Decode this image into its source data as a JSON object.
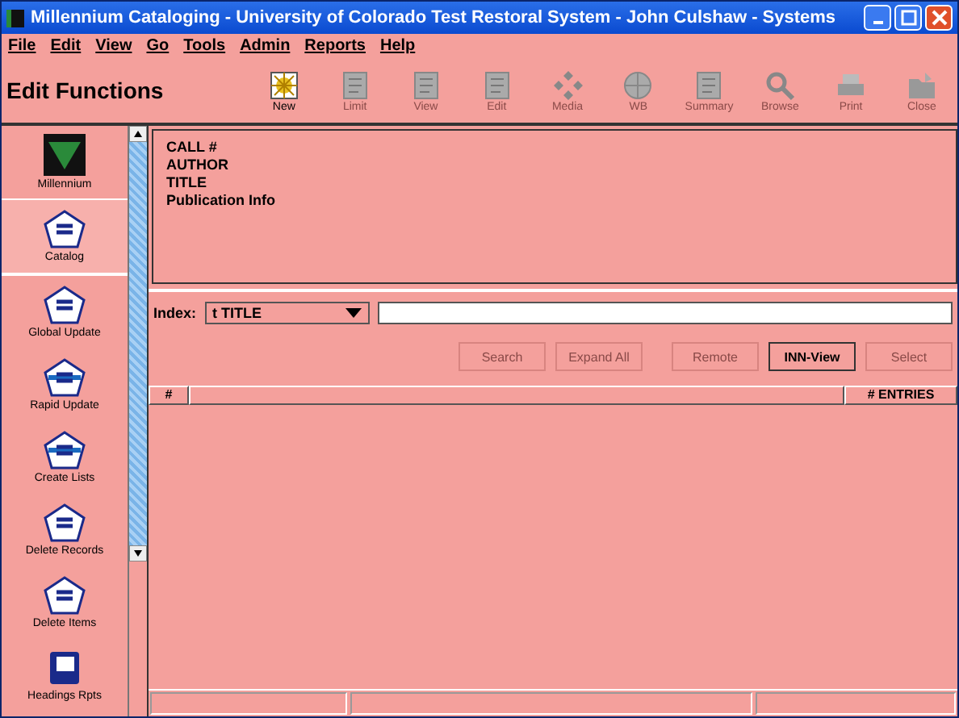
{
  "window": {
    "title": "Millennium Cataloging - University of Colorado Test Restoral System - John Culshaw - Systems"
  },
  "menu": [
    "File",
    "Edit",
    "View",
    "Go",
    "Tools",
    "Admin",
    "Reports",
    "Help"
  ],
  "toolbar": {
    "title": "Edit Functions",
    "items": [
      {
        "label": "New",
        "kind": "new",
        "disabled": false
      },
      {
        "label": "Limit",
        "kind": "limit",
        "disabled": true
      },
      {
        "label": "View",
        "kind": "view",
        "disabled": true
      },
      {
        "label": "Edit",
        "kind": "edit",
        "disabled": true
      },
      {
        "label": "Media",
        "kind": "media",
        "disabled": true
      },
      {
        "label": "WB",
        "kind": "web",
        "disabled": true
      },
      {
        "label": "Summary",
        "kind": "summary",
        "disabled": true
      },
      {
        "label": "Browse",
        "kind": "browse",
        "disabled": true
      },
      {
        "label": "Print",
        "kind": "print",
        "disabled": true
      },
      {
        "label": "Close",
        "kind": "close",
        "disabled": true
      }
    ]
  },
  "sidebar": {
    "items": [
      {
        "label": "Millennium",
        "kind": "logo",
        "selected": false
      },
      {
        "label": "Catalog",
        "kind": "catalog",
        "selected": true
      },
      {
        "label": "Global Update",
        "kind": "global",
        "selected": false
      },
      {
        "label": "Rapid Update",
        "kind": "rapid",
        "selected": false
      },
      {
        "label": "Create Lists",
        "kind": "lists",
        "selected": false
      },
      {
        "label": "Delete Records",
        "kind": "delrec",
        "selected": false
      },
      {
        "label": "Delete Items",
        "kind": "delitem",
        "selected": false
      },
      {
        "label": "Headings Rpts",
        "kind": "headings",
        "selected": false
      }
    ]
  },
  "record_fields": [
    "CALL #",
    "AUTHOR",
    "TITLE",
    "Publication Info"
  ],
  "search": {
    "index_label": "Index:",
    "index_value": "t TITLE"
  },
  "buttons": [
    {
      "label": "Search",
      "disabled": true
    },
    {
      "label": "Expand All",
      "disabled": true
    },
    {
      "label": "Remote",
      "disabled": true
    },
    {
      "label": "INN-View",
      "disabled": false
    },
    {
      "label": "Select",
      "disabled": true
    }
  ],
  "table": {
    "columns": [
      "#",
      "",
      "# ENTRIES"
    ]
  }
}
